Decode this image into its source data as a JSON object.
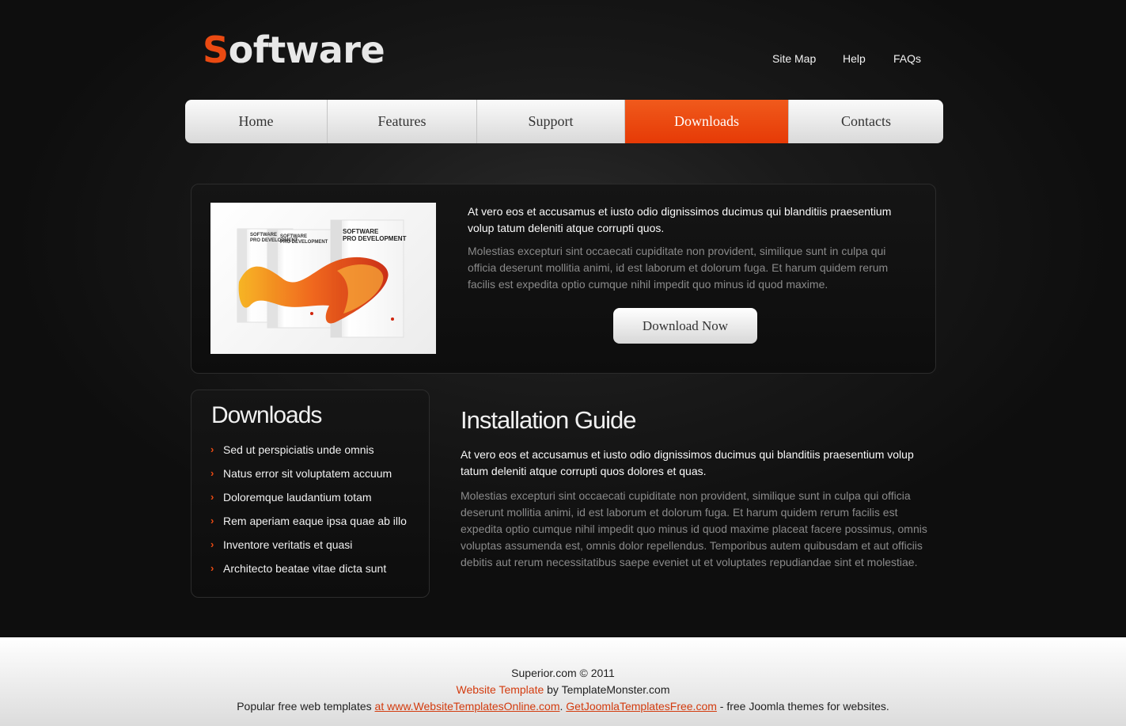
{
  "brand": {
    "first_letter": "S",
    "rest": "oftware"
  },
  "top_links": [
    "Site Map",
    "Help",
    "FAQs"
  ],
  "nav": {
    "tabs": [
      {
        "label": "Home"
      },
      {
        "label": "Features"
      },
      {
        "label": "Support"
      },
      {
        "label": "Downloads",
        "active": true
      },
      {
        "label": "Contacts"
      }
    ]
  },
  "feature": {
    "product_box_text": {
      "line1": "SOFTWARE",
      "line2": "PRO DEVELOPMENT"
    },
    "lead": "At vero eos et accusamus et iusto odio dignissimos ducimus qui blanditiis praesentium volup tatum deleniti atque corrupti quos.",
    "body": "Molestias excepturi sint occaecati cupiditate non provident, similique sunt in culpa qui officia deserunt mollitia animi, id est laborum et dolorum fuga. Et harum quidem rerum facilis est expedita optio cumque nihil impedit quo minus id quod maxime.",
    "button": "Download Now"
  },
  "downloads": {
    "title": "Downloads",
    "items": [
      "Sed ut perspiciatis unde omnis",
      "Natus error sit voluptatem accuum",
      "Doloremque laudantium totam",
      "Rem aperiam eaque ipsa quae ab illo",
      "Inventore veritatis et quasi",
      "Architecto beatae vitae dicta sunt"
    ]
  },
  "guide": {
    "title": "Installation Guide",
    "lead": "At vero eos et accusamus et iusto odio dignissimos ducimus qui blanditiis praesentium volup tatum deleniti atque corrupti quos dolores et quas.",
    "body": "Molestias excepturi sint occaecati cupiditate non provident, similique sunt in culpa qui officia deserunt mollitia animi, id est laborum et dolorum fuga. Et harum quidem rerum facilis est expedita optio cumque nihil impedit quo minus id quod maxime placeat facere possimus, omnis voluptas assumenda est, omnis dolor repellendus. Temporibus autem quibusdam et aut officiis debitis aut rerum necessitatibus saepe eveniet ut et voluptates repudiandae sint et molestiae."
  },
  "footer": {
    "copyright": "Superior.com © 2011",
    "template_link": "Website Template",
    "template_by": " by TemplateMonster.com",
    "popular_prefix": "Popular free web templates ",
    "link1": "at www.WebsiteTemplatesOnline.com",
    "sep": ". ",
    "link2": "GetJoomlaTemplatesFree.com",
    "suffix": " - free Joomla themes for websites."
  },
  "colors": {
    "accent": "#ea4a12",
    "background": "#111111",
    "footer_bg": "#f2f2f2"
  }
}
